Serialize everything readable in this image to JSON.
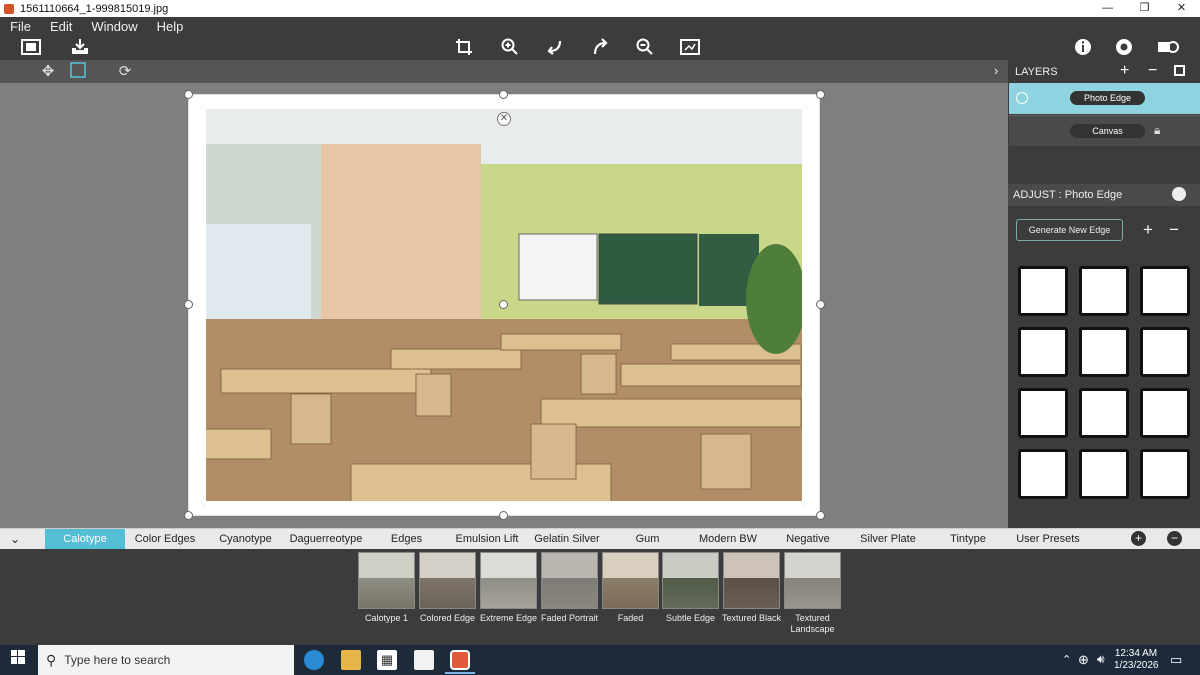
{
  "window": {
    "title": "1561110664_1-999815019.jpg",
    "minimize": "—",
    "maximize": "❐",
    "close": "✕"
  },
  "menu": [
    "File",
    "Edit",
    "Window",
    "Help"
  ],
  "layers": {
    "header": "LAYERS",
    "add": "+",
    "remove": "−",
    "items": [
      {
        "label": "Photo Edge"
      },
      {
        "label": "Canvas"
      }
    ]
  },
  "adjust": {
    "header": "ADJUST : Photo Edge",
    "generate_button": "Generate New Edge",
    "add": "+",
    "remove": "−"
  },
  "tabs": [
    "Calotype",
    "Color Edges",
    "Cyanotype",
    "Daguerreotype",
    "Edges",
    "Emulsion Lift",
    "Gelatin Silver",
    "Gum Bichromate",
    "Modern BW",
    "Negative",
    "Silver Plate",
    "Tintype",
    "User Presets"
  ],
  "active_tab": "Calotype",
  "presets": [
    "Calotype 1",
    "Colored Edge",
    "Extreme Edge",
    "Faded Portrait",
    "Faded",
    "Subtle Edge",
    "Textured Black",
    "Textured Landscape"
  ],
  "taskbar": {
    "search_placeholder": "Type here to search",
    "time": "12:34 AM",
    "date": "1/23/2026"
  },
  "colors": {
    "accent": "#54bed4",
    "panel": "#3c3c3c"
  }
}
